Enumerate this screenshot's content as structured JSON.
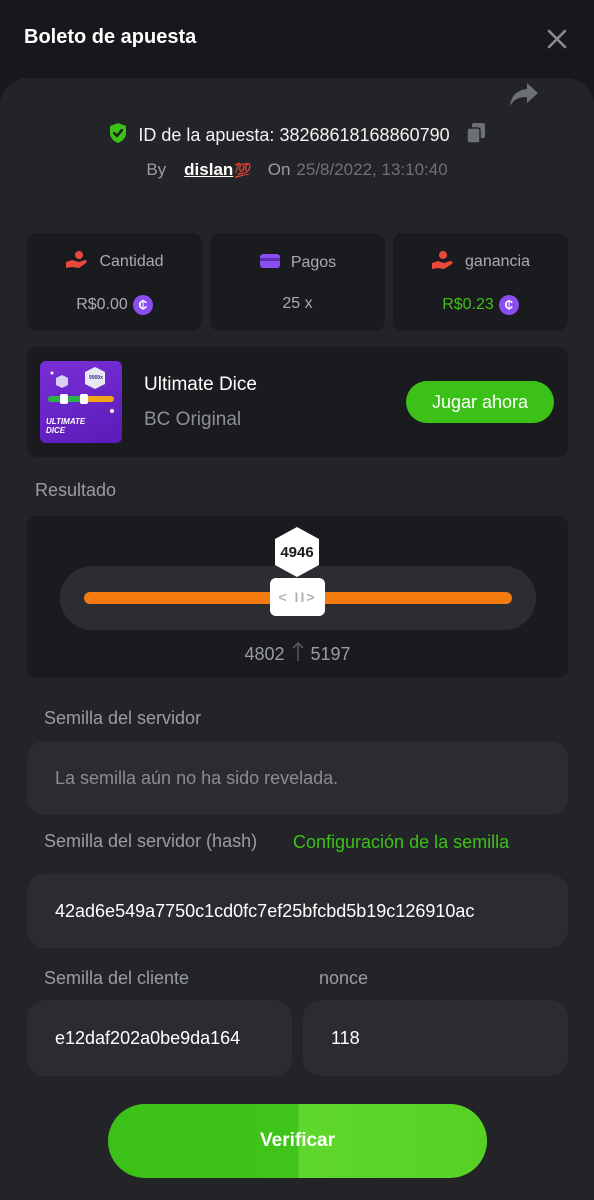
{
  "header": {
    "title": "Boleto de apuesta"
  },
  "bet": {
    "id_label": "ID de la apuesta:",
    "id_value": "38268618168860790",
    "by_label": "By",
    "username": "dislan",
    "user_emoji": "💯",
    "on_label": "On",
    "datetime": "25/8/2022, 13:10:40"
  },
  "stats": [
    {
      "label": "Cantidad",
      "value": "R$0.00",
      "icon": "hand-coins-icon",
      "icon_color": "#e8493c",
      "value_color": "#a9abb1",
      "coin": "₵"
    },
    {
      "label": "Pagos",
      "value": "25 x",
      "icon": "card-icon",
      "icon_color": "#8a4df0",
      "value_color": "#a9abb1"
    },
    {
      "label": "ganancia",
      "value": "R$0.23",
      "icon": "hand-profit-icon",
      "icon_color": "#e8493c",
      "value_color": "#3bc117",
      "coin": "₵"
    }
  ],
  "game": {
    "name": "Ultimate Dice",
    "provider": "BC Original",
    "play_label": "Jugar ahora",
    "thumb_text": "ULTIMATE DICE",
    "thumb_badge": "9900x"
  },
  "result": {
    "label": "Resultado",
    "value": "4946",
    "range_low": "4802",
    "range_high": "5197",
    "handle_glyph": "< II>"
  },
  "server_seed": {
    "label": "Semilla del servidor",
    "placeholder": "La semilla aún no ha sido revelada."
  },
  "server_hash": {
    "label": "Semilla del servidor (hash)",
    "link": "Configuración de la semilla",
    "value": "42ad6e549a7750c1cd0fc7ef25bfcbd5b19c126910ac"
  },
  "client_seed": {
    "label": "Semilla del cliente",
    "value": "e12daf202a0be9da164"
  },
  "nonce": {
    "label": "nonce",
    "value": "118"
  },
  "verify_label": "Verificar",
  "colors": {
    "accent_green": "#3bc117",
    "orange": "#f47b0f",
    "purple": "#8a4df0",
    "panel": "#232427",
    "card": "#1a1b1e"
  }
}
